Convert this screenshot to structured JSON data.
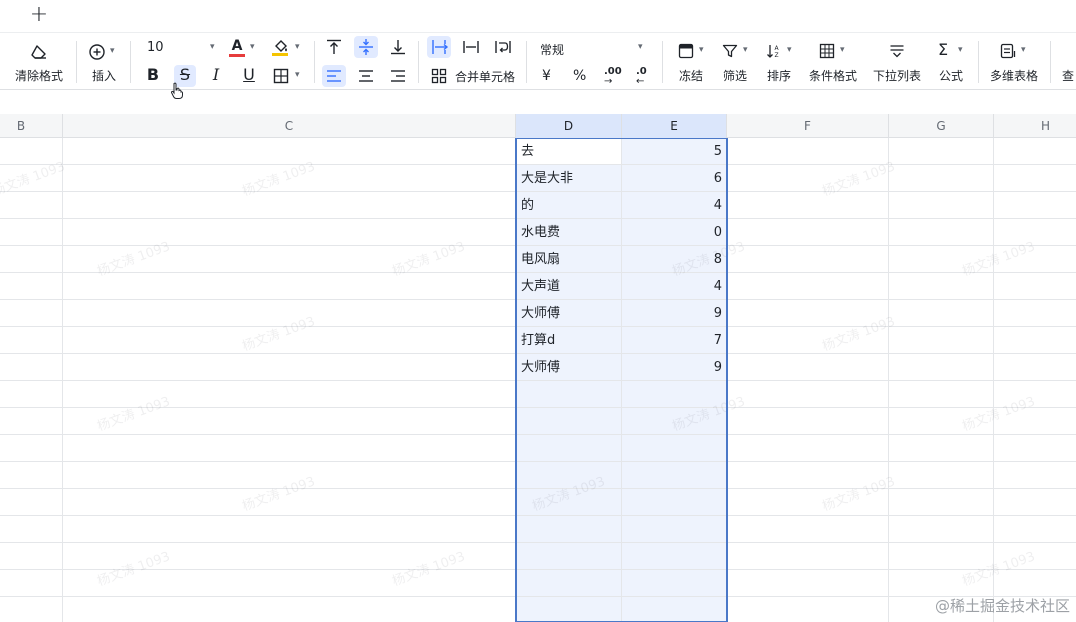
{
  "topbar": {
    "add_icon": "plus-icon"
  },
  "toolbar": {
    "clear_format": "清除格式",
    "insert": "插入",
    "font_size": "10",
    "merge_cells": "合并单元格",
    "number_format": "常规",
    "currency_symbol": "¥",
    "percent_symbol": "%",
    "freeze": "冻结",
    "filter": "筛选",
    "sort": "排序",
    "conditional_format": "条件格式",
    "dropdown_list": "下拉列表",
    "formula": "公式",
    "multi_table": "多维表格",
    "more": "查"
  },
  "colors": {
    "font_color_bar": "#e63c3c",
    "fill_color_bar": "#f5c400",
    "accent": "#3370ff"
  },
  "columns": [
    "B",
    "C",
    "D",
    "E",
    "F",
    "G",
    "H"
  ],
  "rows": [
    {
      "d": "去",
      "e": "5"
    },
    {
      "d": "大是大非",
      "e": "6"
    },
    {
      "d": "的",
      "e": "4"
    },
    {
      "d": "水电费",
      "e": "0"
    },
    {
      "d": "电风扇",
      "e": "8"
    },
    {
      "d": "大声道",
      "e": "4"
    },
    {
      "d": "大师傅",
      "e": "9"
    },
    {
      "d": "打算d",
      "e": "7"
    },
    {
      "d": "大师傅",
      "e": "9"
    }
  ],
  "watermark": "杨文涛 1093",
  "footer_watermark": "@稀土掘金技术社区"
}
